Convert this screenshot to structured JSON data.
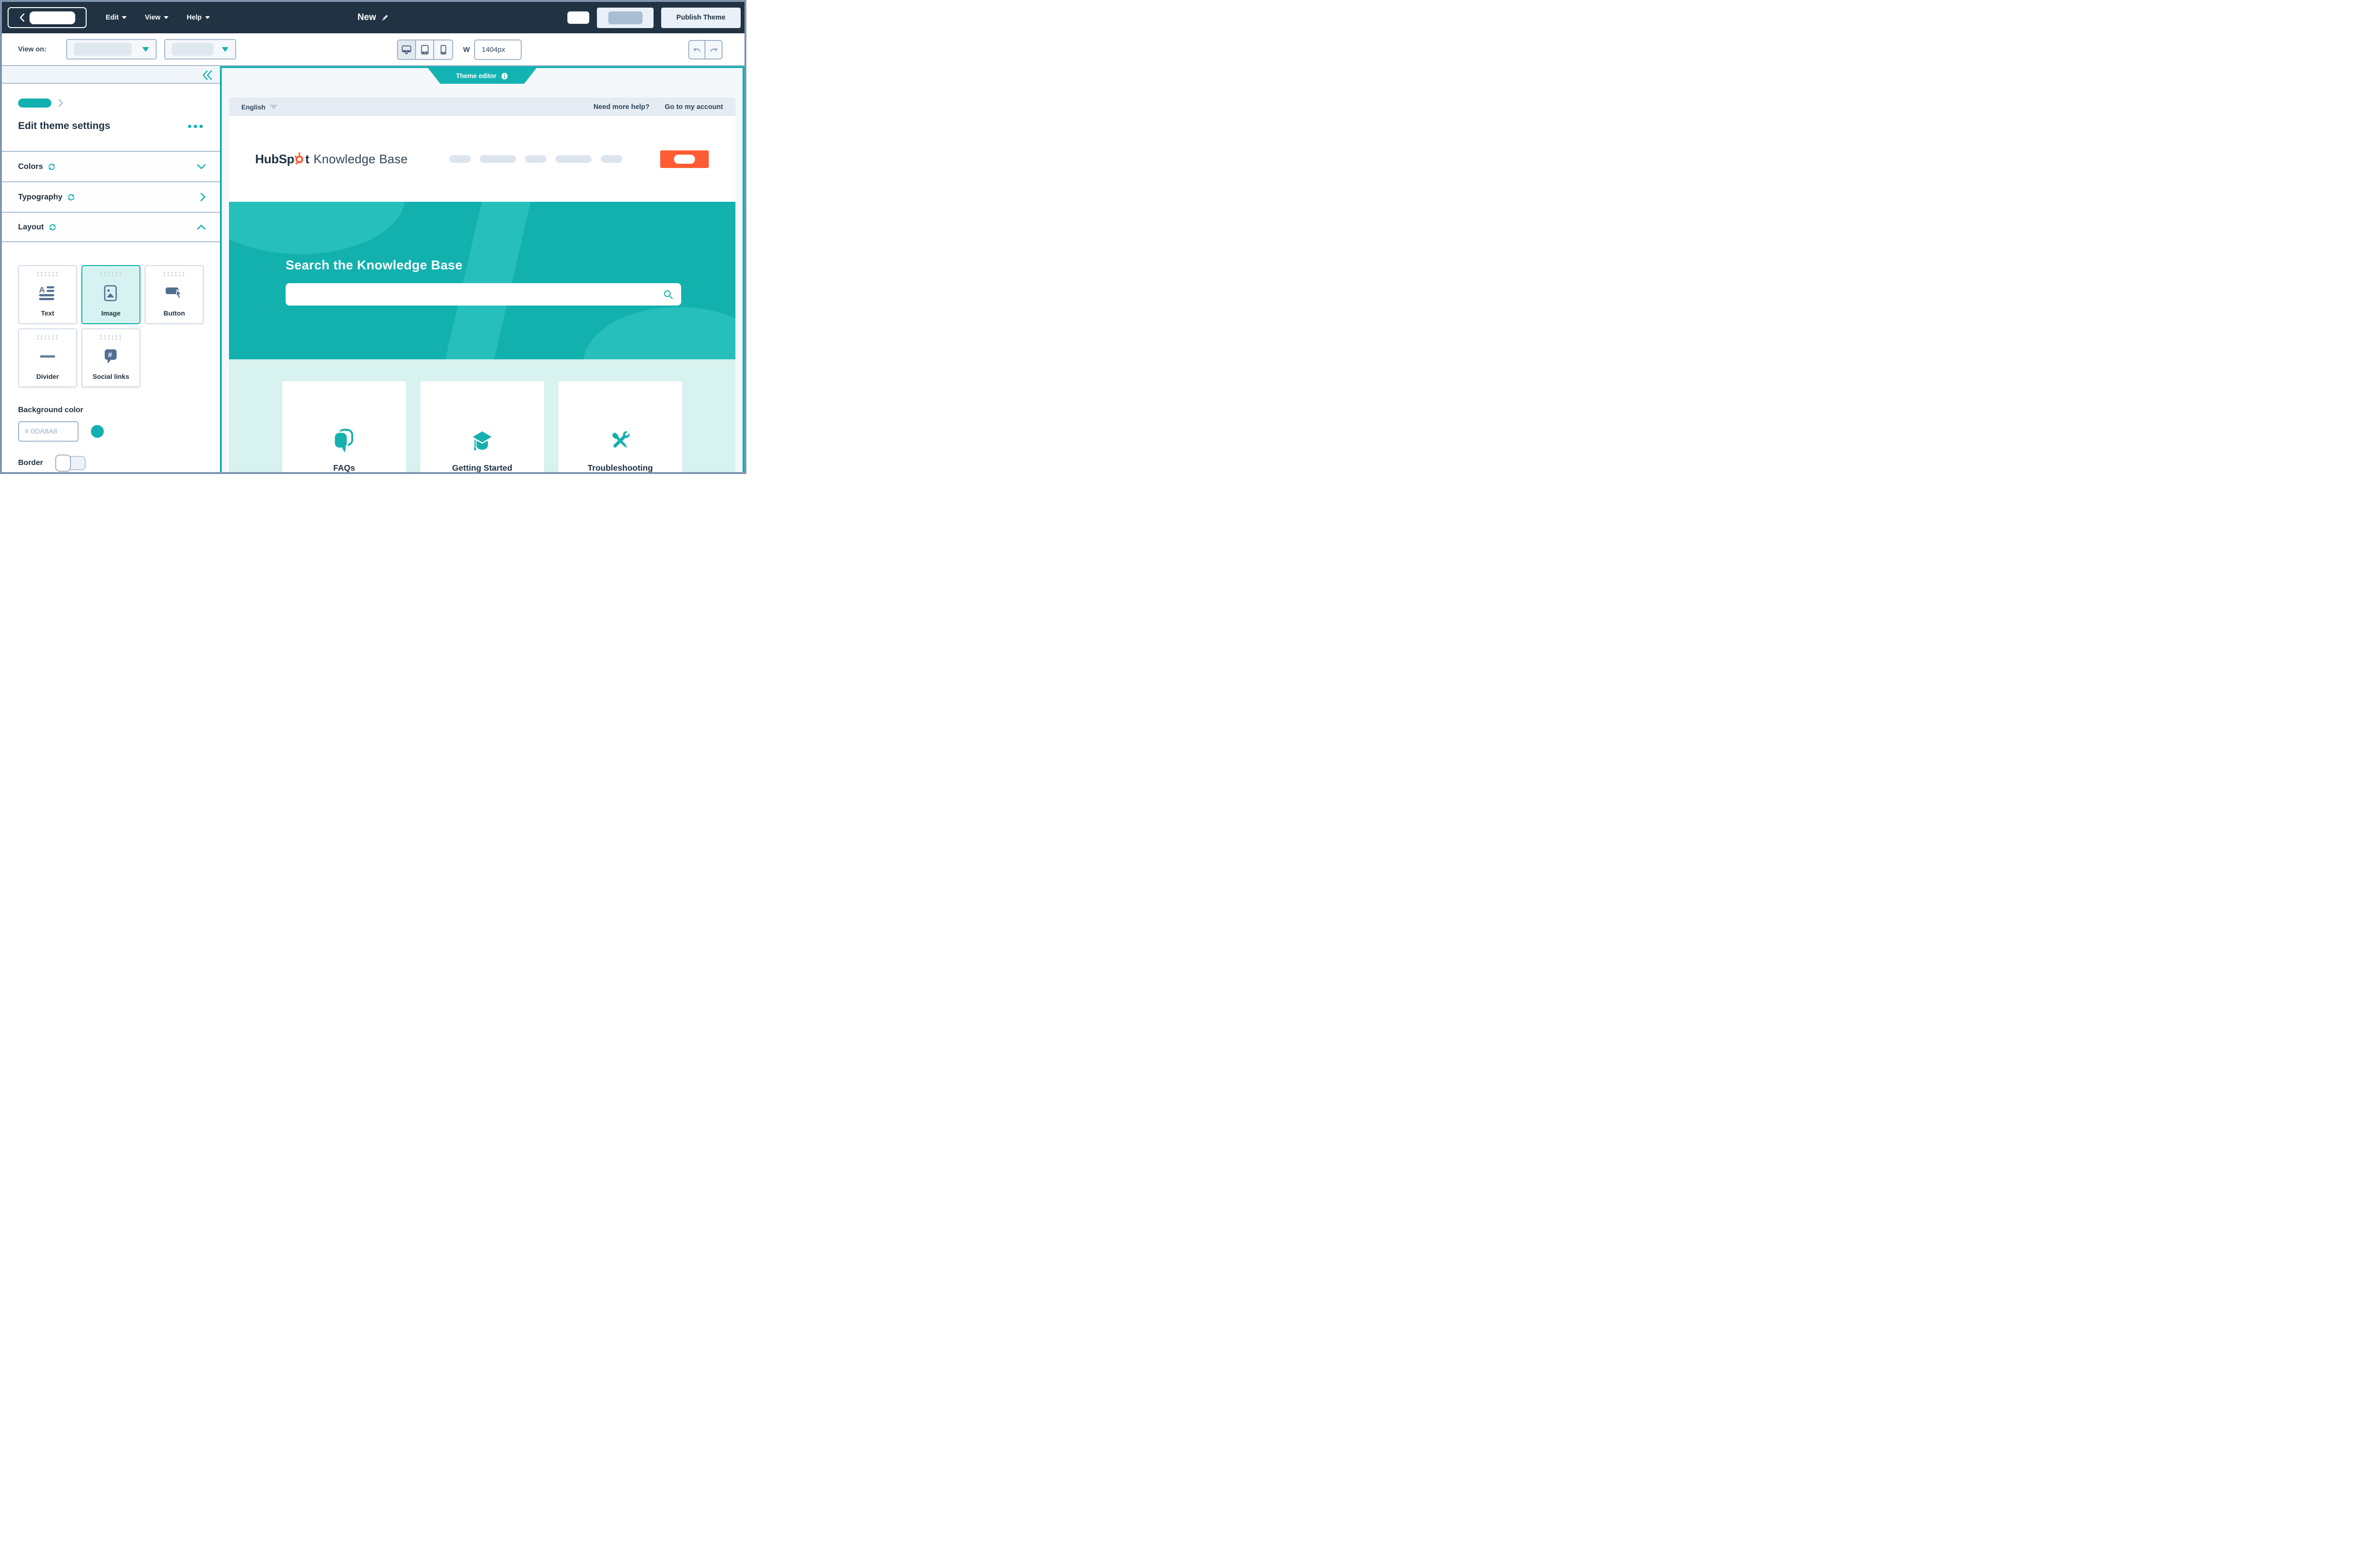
{
  "header": {
    "menus": [
      {
        "label": "Edit"
      },
      {
        "label": "View"
      },
      {
        "label": "Help"
      }
    ],
    "title": "New",
    "publish_label": "Publish Theme"
  },
  "toolbar": {
    "view_on_label": "View on:",
    "width_label": "W",
    "width_value": "1404px"
  },
  "sidebar": {
    "heading": "Edit theme settings",
    "sections": [
      {
        "label": "Colors"
      },
      {
        "label": "Typography"
      },
      {
        "label": "Layout"
      }
    ],
    "layout_cards": [
      {
        "label": "Text"
      },
      {
        "label": "Image"
      },
      {
        "label": "Button"
      },
      {
        "label": "Divider"
      },
      {
        "label": "Social links"
      }
    ],
    "background_color": {
      "label": "Background color",
      "placeholder": "# 0DA8A8",
      "swatch_color": "#12B0B0"
    },
    "border_label": "Border"
  },
  "preview": {
    "tab_label": "Theme editor",
    "language": "English",
    "links": {
      "help": "Need more help?",
      "account": "Go to my account"
    },
    "logo": {
      "brand": "HubSp",
      "brand_end": "t",
      "suffix": "Knowledge Base"
    },
    "hero": {
      "heading": "Search the Knowledge Base"
    },
    "cards": [
      {
        "label": "FAQs"
      },
      {
        "label": "Getting Started"
      },
      {
        "label": "Troubleshooting"
      }
    ]
  },
  "colors": {
    "navy": "#213343",
    "accent_teal": "#0DA8A8",
    "ui_teal": "#12B1AE",
    "orange": "#FF5C35",
    "mint": "#D7F2EF",
    "frame": "#8094B0"
  }
}
